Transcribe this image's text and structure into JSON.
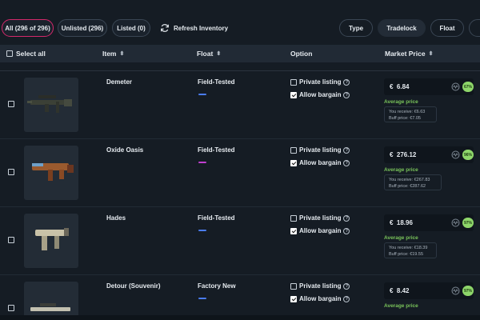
{
  "topbar": {
    "tabs": [
      {
        "label": "All (296 of 296)",
        "active": true
      },
      {
        "label": "Unlisted (296)",
        "active": false
      },
      {
        "label": "Listed (0)",
        "active": false
      }
    ],
    "refresh_label": "Refresh Inventory",
    "filters": [
      "Type",
      "Tradelock",
      "Float"
    ]
  },
  "table": {
    "select_all_label": "Select all",
    "columns": {
      "item": "Item",
      "float": "Float",
      "option": "Option",
      "market_price": "Market Price"
    },
    "sort_glyph": "⬍"
  },
  "option_labels": {
    "private": "Private listing",
    "bargain": "Allow bargain"
  },
  "price_labels": {
    "average": "Average price",
    "currency": "€"
  },
  "rows": [
    {
      "name": "Demeter",
      "wear": "Field-Tested",
      "float_color": "#4a7cf0",
      "price": "6.84",
      "pct": "67%",
      "receive": "You receive: €6.63",
      "buff": "Buff price: €7.05",
      "private": false,
      "bargain": true
    },
    {
      "name": "Oxide Oasis",
      "wear": "Field-Tested",
      "float_color": "#c13fd0",
      "price": "276.12",
      "pct": "96%",
      "receive": "You receive: €267.83",
      "buff": "Buff price: €287.62",
      "private": false,
      "bargain": true
    },
    {
      "name": "Hades",
      "wear": "Field-Tested",
      "float_color": "#4a7cf0",
      "price": "18.96",
      "pct": "97%",
      "receive": "You receive: €18.39",
      "buff": "Buff price: €19.55",
      "private": false,
      "bargain": true
    },
    {
      "name": "Detour (Souvenir)",
      "wear": "Factory New",
      "float_color": "#4a7cf0",
      "price": "8.42",
      "pct": "97%",
      "receive": "",
      "buff": "",
      "private": false,
      "bargain": true
    }
  ]
}
